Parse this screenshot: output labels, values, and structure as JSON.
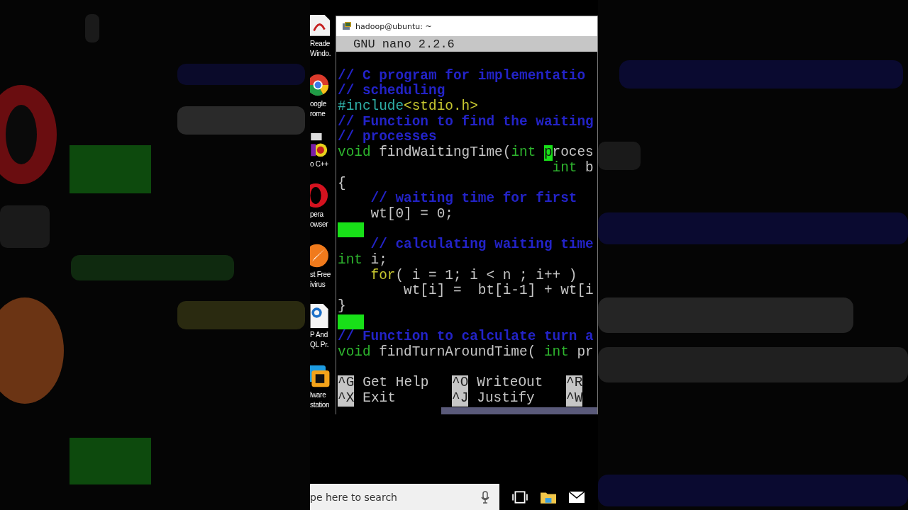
{
  "desktop_icons": [
    {
      "kind": "pdf",
      "lines": [
        "Reade",
        "Windo."
      ]
    },
    {
      "kind": "chrome",
      "lines": [
        "oogle",
        "rome"
      ]
    },
    {
      "kind": "devcpp",
      "lines": [
        "o C++"
      ]
    },
    {
      "kind": "opera",
      "lines": [
        "pera",
        "owser"
      ]
    },
    {
      "kind": "avast",
      "lines": [
        "st Free",
        "ivirus"
      ]
    },
    {
      "kind": "pdfedit",
      "lines": [
        "P And",
        "QL Pr."
      ]
    },
    {
      "kind": "vmware",
      "lines": [
        "lware",
        "station"
      ]
    }
  ],
  "terminal": {
    "title": "hadoop@ubuntu: ~",
    "header": "GNU nano 2.2.6",
    "lines": [
      {
        "kind": "blank"
      },
      {
        "kind": "code",
        "segments": [
          {
            "kind": "comment",
            "text": "// C program for implementatio"
          }
        ]
      },
      {
        "kind": "code",
        "segments": [
          {
            "kind": "comment",
            "text": "// scheduling"
          }
        ]
      },
      {
        "kind": "code",
        "segments": [
          {
            "kind": "preproc",
            "text": "#include"
          },
          {
            "kind": "string",
            "text": "<stdio.h>"
          }
        ]
      },
      {
        "kind": "code",
        "segments": [
          {
            "kind": "comment",
            "text": "// Function to find the waiting"
          }
        ]
      },
      {
        "kind": "code",
        "segments": [
          {
            "kind": "comment",
            "text": "// processes"
          }
        ]
      },
      {
        "kind": "code",
        "segments": [
          {
            "kind": "type",
            "text": "void"
          },
          {
            "kind": "plain",
            "text": " findWaitingTime("
          },
          {
            "kind": "type",
            "text": "int "
          },
          {
            "kind": "cursor",
            "text": "p"
          },
          {
            "kind": "plain",
            "text": "roces"
          }
        ]
      },
      {
        "kind": "code",
        "segments": [
          {
            "kind": "type",
            "text": "                          int"
          },
          {
            "kind": "plain",
            "text": " b"
          }
        ]
      },
      {
        "kind": "code",
        "segments": [
          {
            "kind": "plain",
            "text": "{"
          }
        ]
      },
      {
        "kind": "code",
        "segments": [
          {
            "kind": "comment",
            "text": "    // waiting time for first"
          }
        ]
      },
      {
        "kind": "code",
        "segments": [
          {
            "kind": "plain",
            "text": "    wt[0] = 0;"
          }
        ]
      },
      {
        "kind": "marked_whitespace"
      },
      {
        "kind": "code",
        "segments": [
          {
            "kind": "comment",
            "text": "    // calculating waiting time"
          }
        ]
      },
      {
        "kind": "code",
        "segments": [
          {
            "kind": "type",
            "text": "int"
          },
          {
            "kind": "plain",
            "text": " i;"
          }
        ]
      },
      {
        "kind": "code",
        "segments": [
          {
            "kind": "keyword",
            "text": "    for"
          },
          {
            "kind": "plain",
            "text": "( i = 1; i < n ; i++ )"
          }
        ]
      },
      {
        "kind": "code",
        "segments": [
          {
            "kind": "plain",
            "text": "        wt[i] =  bt[i-1] + wt[i"
          }
        ]
      },
      {
        "kind": "code",
        "segments": [
          {
            "kind": "plain",
            "text": "}"
          }
        ]
      },
      {
        "kind": "marked_whitespace"
      },
      {
        "kind": "code",
        "segments": [
          {
            "kind": "comment",
            "text": "// Function to calculate turn a"
          }
        ]
      },
      {
        "kind": "code",
        "segments": [
          {
            "kind": "type",
            "text": "void"
          },
          {
            "kind": "plain",
            "text": " findTurnAroundTime( "
          },
          {
            "kind": "type",
            "text": "int"
          },
          {
            "kind": "plain",
            "text": " pr"
          }
        ]
      },
      {
        "kind": "blank"
      }
    ],
    "shortcuts": [
      [
        {
          "key": "^G",
          "label": "Get Help"
        },
        {
          "key": "^O",
          "label": "WriteOut"
        },
        {
          "key": "^R"
        }
      ],
      [
        {
          "key": "^X",
          "label": "Exit"
        },
        {
          "key": "^J",
          "label": "Justify"
        },
        {
          "key": "^W"
        }
      ]
    ]
  },
  "taskbar": {
    "search": {
      "placeholder": "pe here to search"
    }
  }
}
